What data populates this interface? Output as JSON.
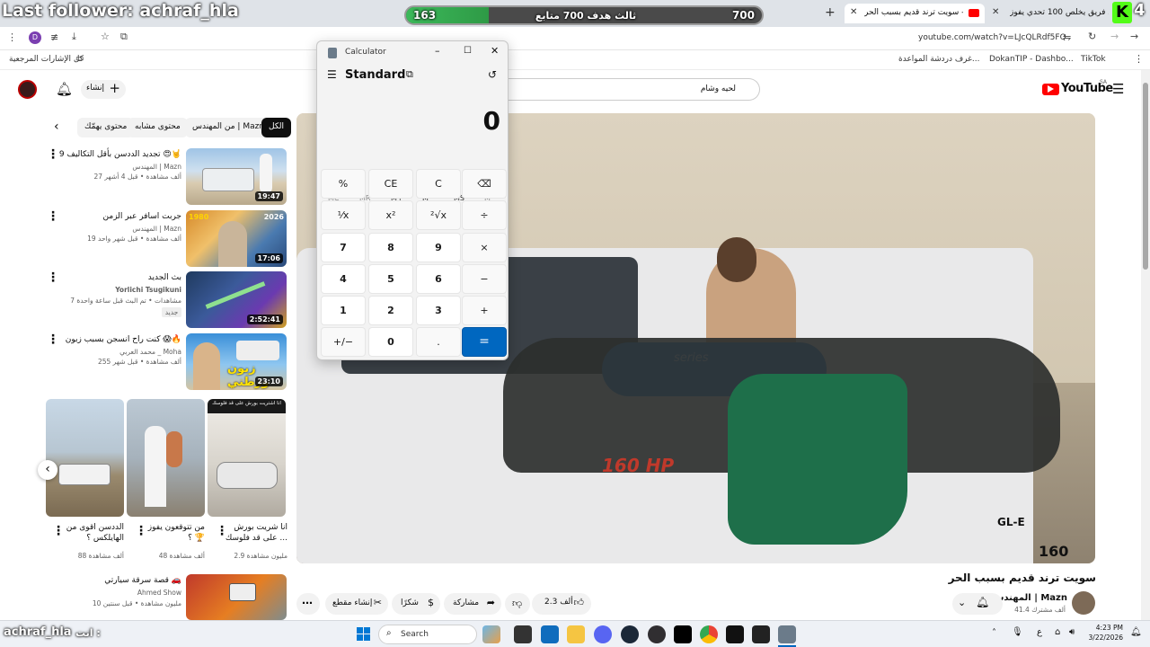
{
  "overlay": {
    "last_follower": "Last follower: achraf_hla",
    "goal_current": "163",
    "goal_text": "ثالث هدف 700 متابع",
    "goal_target": "700",
    "goal_progress": 0.233,
    "corner_number": "4",
    "chat_user": "achraf_hla",
    "chat_text": "انت :"
  },
  "browser": {
    "tabs": [
      {
        "title": "سويت ترند قديم بسبب الحر - ube"
      },
      {
        "title": "أول فريق يخلص 100 تحدي يفوز"
      }
    ],
    "new_tab": "+",
    "url": "youtube.com/watch?v=LJcQLRdf5FQ",
    "profile_letter": "D"
  },
  "bookmarks": {
    "left_label": "كل الإشارات المرجعية",
    "items": [
      "غرف دردشة المواعدة...",
      "DokanTIP - Dashbo...",
      "TikTok"
    ]
  },
  "youtube": {
    "logo": "YouTube",
    "region": "SA",
    "search_value": "لحيه وشام",
    "create_label": "إنشاء",
    "chips": [
      "الكل",
      "من المهندس | Mazn",
      "محتوى مشابه",
      "محتوى يهمّك"
    ],
    "sidebar_videos": [
      {
        "title": "تجديد الددسن بأقل التكاليف 9 😍🤘",
        "channel": "المهندس | Mazn",
        "meta": "27 ألف مشاهدة • قبل 4 أشهر",
        "duration": "19:47"
      },
      {
        "title": "جربت اسافر عبر الزمن",
        "channel": "المهندس | Mazn",
        "meta": "19 ألف مشاهدة • قبل شهر واحد",
        "duration": "17:06"
      },
      {
        "title": "بث الجديد",
        "channel": "Yorlichi Tsugikuni",
        "meta": "7 مشاهدات • تم البث قبل ساعة واحدة",
        "badge": "جديد",
        "duration": "2:52:41"
      },
      {
        "title": "كنت راح انسجن بسبب زبون 😱🔥",
        "channel": "محمد العربي _ Moha",
        "meta": "255 ألف مشاهدة • قبل شهر",
        "duration": "23:10"
      }
    ],
    "shorts": [
      {
        "title": "الددسن اقوى من الهايلكس ؟",
        "views": "88 ألف مشاهدة"
      },
      {
        "title": "من تتوقعون يفوز ؟ 🏆",
        "views": "48 ألف مشاهدة"
      },
      {
        "title": "انا شريت بورش على قد فلوسك ...",
        "views": "2.9 مليون مشاهدة",
        "thumb_caption": "انا اشتريت بورش على قد فلوسك"
      }
    ],
    "last_video": {
      "title": "قصة سرقة سيارتي 🚗",
      "channel": "Ahmed Show",
      "meta": "10 مليون مشاهدة • قبل سنتين"
    },
    "video_title": "سويت ترند قديم بسبب الحر",
    "channel_name": "المهندس | Mazn",
    "subscribers": "41.4 ألف مشترك",
    "likes": "2.3 ألف",
    "share_label": "مشاركة",
    "thanks_label": "شكرًا",
    "clip_label": "إنشاء مقطع",
    "plate_text": "160 HP",
    "plate_text2": "GL-E",
    "plate_text3": "160",
    "float_text": "series"
  },
  "calculator": {
    "app_title": "Calculator",
    "mode": "Standard",
    "display": "0",
    "memory": [
      "MC",
      "MR",
      "M+",
      "M−",
      "MS",
      "M˅"
    ],
    "keys": [
      [
        "%",
        "CE",
        "C",
        "⌫"
      ],
      [
        "¹⁄x",
        "x²",
        "²√x",
        "÷"
      ],
      [
        "7",
        "8",
        "9",
        "×"
      ],
      [
        "4",
        "5",
        "6",
        "−"
      ],
      [
        "1",
        "2",
        "3",
        "+"
      ],
      [
        "+/−",
        "0",
        ".",
        "="
      ]
    ]
  },
  "taskbar": {
    "search": "Search",
    "time": "4:23 PM",
    "date": "3/22/2026",
    "lang": "ع"
  }
}
